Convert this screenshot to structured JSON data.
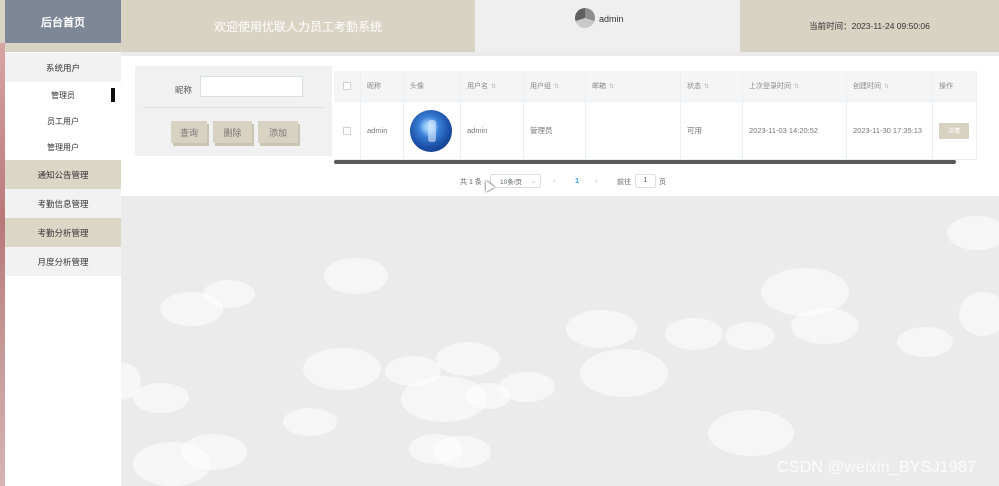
{
  "header": {
    "brand": "后台首页",
    "welcome": "欢迎使用优联人力员工考勤系统",
    "username": "admin",
    "time_label": "当前时间：2023-11-24 09:50:06"
  },
  "sidebar": {
    "group": "系统用户",
    "sub_items": [
      {
        "label": "管理员",
        "active": true
      },
      {
        "label": "员工用户",
        "active": false
      },
      {
        "label": "管理用户",
        "active": false
      }
    ],
    "items": [
      {
        "label": "通知公告管理"
      },
      {
        "label": "考勤信息管理"
      },
      {
        "label": "考勤分析管理"
      },
      {
        "label": "月度分析管理"
      }
    ]
  },
  "search": {
    "label": "昵称",
    "value": "",
    "buttons": {
      "query": "查询",
      "delete": "删除",
      "add": "添加"
    }
  },
  "table": {
    "columns": [
      "昵称",
      "头像",
      "用户名",
      "用户组",
      "邮箱",
      "状态",
      "上次登录时间",
      "创建时间",
      "操作"
    ],
    "rows": [
      {
        "nickname": "admin",
        "username": "admin",
        "group": "管理员",
        "email": "",
        "status": "可用",
        "last_login": "2023-11-03 14:20:52",
        "created": "2023-11-30 17:35:13",
        "action": "详情"
      }
    ]
  },
  "pagination": {
    "total": "共 1 条",
    "page_size": "10条/页",
    "current_page": "1",
    "goto_label": "前往",
    "goto_value": "1",
    "goto_unit": "页"
  },
  "watermark": "CSDN @weixin_BYSJ1987",
  "colors": {
    "accent": "#d8d2c3",
    "brand_bg": "#7e8796",
    "active_page": "#409eff"
  }
}
